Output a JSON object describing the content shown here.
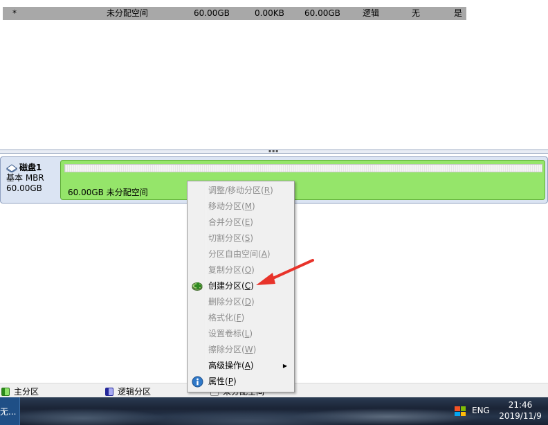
{
  "table_row": [
    "*",
    "未分配空间",
    "60.00GB",
    "0.00KB",
    "60.00GB",
    "逻辑",
    "无",
    "是"
  ],
  "disk": {
    "name": "磁盘1",
    "type": "基本 MBR",
    "size": "60.00GB",
    "partition_label": "60.00GB 未分配空间"
  },
  "context_menu": {
    "items": [
      {
        "label": "调整/移动分区(",
        "key": "R",
        "enabled": false
      },
      {
        "label": "移动分区(",
        "key": "M",
        "enabled": false
      },
      {
        "label": "合并分区(",
        "key": "E",
        "enabled": false
      },
      {
        "label": "切割分区(",
        "key": "S",
        "enabled": false
      },
      {
        "label": "分区自由空间(",
        "key": "A",
        "enabled": false
      },
      {
        "label": "复制分区(",
        "key": "O",
        "enabled": false
      },
      {
        "label": "创建分区(",
        "key": "C",
        "enabled": true,
        "icon": "create-partition-icon"
      },
      {
        "label": "删除分区(",
        "key": "D",
        "enabled": false
      },
      {
        "label": "格式化(",
        "key": "F",
        "enabled": false
      },
      {
        "label": "设置卷标(",
        "key": "L",
        "enabled": false
      },
      {
        "label": "擦除分区(",
        "key": "W",
        "enabled": false
      },
      {
        "label": "高级操作(",
        "key": "A",
        "enabled": true,
        "submenu": true
      },
      {
        "label": "属性(",
        "key": "P",
        "enabled": true,
        "icon": "info-icon"
      }
    ]
  },
  "legend": {
    "primary": "主分区",
    "logical": "逻辑分区",
    "unallocated": "未分配空间"
  },
  "taskbar": {
    "item_label": "无...",
    "ime": "ENG",
    "time": "21:46",
    "date": "2019/11/9"
  },
  "colors": {
    "partition_green": "#95e56a",
    "disk_panel": "#dbe4f3",
    "annotation_arrow": "#e8332a"
  }
}
